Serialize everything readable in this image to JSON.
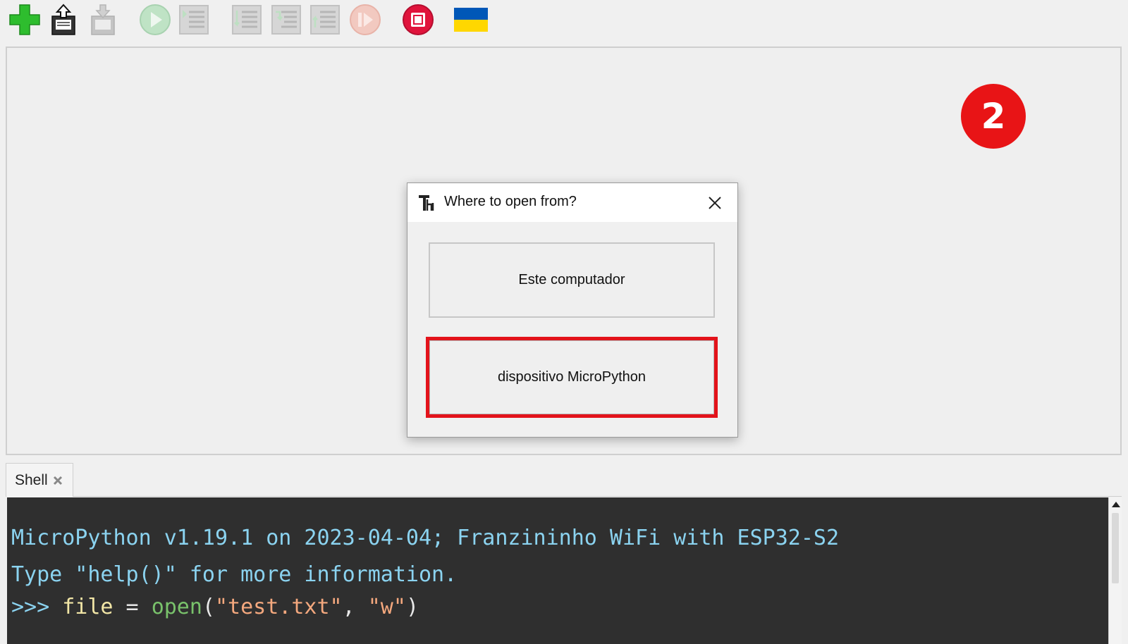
{
  "toolbar": {
    "items": [
      {
        "name": "new-file",
        "icon": "plus-icon",
        "enabled": true
      },
      {
        "name": "open-file",
        "icon": "open-file-icon",
        "enabled": true
      },
      {
        "name": "save-file",
        "icon": "save-icon",
        "enabled": false
      },
      {
        "name": "run",
        "icon": "play-icon",
        "enabled": false
      },
      {
        "name": "debug",
        "icon": "debug-icon",
        "enabled": false
      },
      {
        "name": "step-over",
        "icon": "step-over-icon",
        "enabled": false
      },
      {
        "name": "step-into",
        "icon": "step-into-icon",
        "enabled": false
      },
      {
        "name": "step-out",
        "icon": "step-out-icon",
        "enabled": false
      },
      {
        "name": "resume",
        "icon": "resume-icon",
        "enabled": false
      },
      {
        "name": "stop",
        "icon": "stop-icon",
        "enabled": true
      },
      {
        "name": "ukraine-flag",
        "icon": "ukraine-flag-icon",
        "enabled": true
      }
    ],
    "colors": {
      "green": "#2ebd2e",
      "stop_red": "#e0143c",
      "flag_blue": "#0057b7",
      "flag_yellow": "#ffd700"
    }
  },
  "step_badge": {
    "number": "2",
    "color": "#e81416"
  },
  "dialog": {
    "title": "Where to open from?",
    "option_computer": "Este computador",
    "option_device": "dispositivo MicroPython",
    "highlight_color": "#e3131b"
  },
  "shell": {
    "tab_label": "Shell",
    "line1": "MicroPython v1.19.1 on 2023-04-04; Franzininho WiFi with ESP32-S2",
    "line2": "Type \"help()\" for more information.",
    "prompt": ">>> ",
    "code_name": "file",
    "code_eq": " = ",
    "code_func": "open",
    "code_open_paren": "(",
    "code_arg1": "\"test.txt\"",
    "code_comma": ", ",
    "code_arg2": "\"w\"",
    "code_close_paren": ")"
  }
}
